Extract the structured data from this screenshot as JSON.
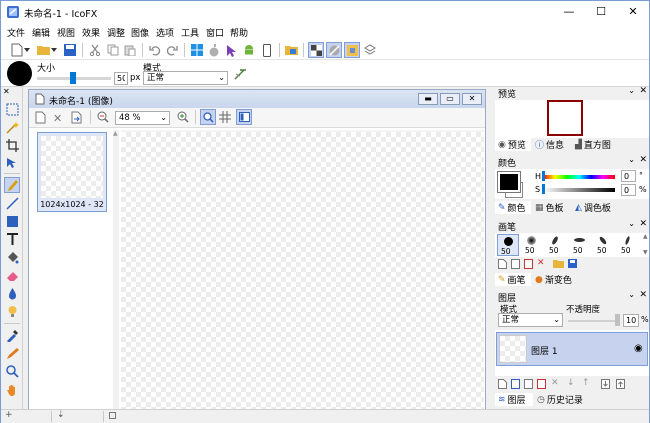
{
  "app": {
    "title": "未命名-1 - IcoFX"
  },
  "window_controls": {
    "minimize": "—",
    "maximize": "☐",
    "close": "✕"
  },
  "menu": [
    "文件",
    "编辑",
    "视图",
    "效果",
    "调整",
    "图像",
    "选项",
    "工具",
    "窗口",
    "帮助"
  ],
  "options": {
    "size_label": "大小",
    "size_value": "50",
    "size_unit": "px",
    "mode_label": "模式",
    "mode_value": "正常"
  },
  "document": {
    "title": "未命名-1 (图像)",
    "zoom": "48 %",
    "thumb_label": "1024x1024 - 32"
  },
  "panels": {
    "preview": {
      "title": "预览",
      "tabs": [
        "预览",
        "信息",
        "直方图"
      ]
    },
    "color": {
      "title": "颜色",
      "h_label": "H",
      "h_value": "0",
      "h_unit": "°",
      "s_label": "S",
      "s_value": "0",
      "s_unit": "%",
      "tabs": [
        "颜色",
        "色板",
        "调色板"
      ]
    },
    "brush": {
      "title": "画笔",
      "presets": [
        "50",
        "50",
        "50",
        "50",
        "50",
        "50"
      ],
      "tabs": [
        "画笔",
        "渐变色"
      ]
    },
    "layers": {
      "title": "图层",
      "mode_label": "模式",
      "opacity_label": "不透明度",
      "mode_value": "正常",
      "opacity_value": "100",
      "opacity_unit": "%",
      "layer_name": "图层 1",
      "tabs": [
        "图层",
        "历史记录"
      ]
    }
  },
  "colors": {
    "accent": "#0078d7",
    "selection": "#c7d3ee",
    "preview_border": "#8b0000",
    "primary_color": "#000000",
    "secondary_color": "#ffffff"
  }
}
